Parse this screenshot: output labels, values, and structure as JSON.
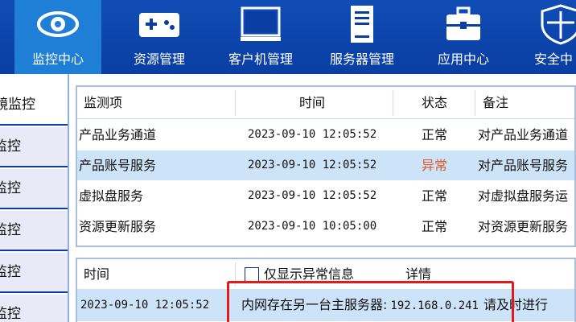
{
  "nav": {
    "items": [
      {
        "label": "监控中心",
        "icon": "eye-icon",
        "active": true
      },
      {
        "label": "资源管理",
        "icon": "gamepad-icon",
        "active": false
      },
      {
        "label": "客户机管理",
        "icon": "monitor-icon",
        "active": false
      },
      {
        "label": "服务器管理",
        "icon": "server-icon",
        "active": false
      },
      {
        "label": "应用中心",
        "icon": "toolbox-icon",
        "active": false
      },
      {
        "label": "安全中",
        "icon": "shield-icon",
        "active": false
      }
    ]
  },
  "sidebar": {
    "items": [
      {
        "label": "镜监控",
        "active": true
      },
      {
        "label": "监控",
        "active": false
      },
      {
        "label": "监控",
        "active": false
      },
      {
        "label": "监控",
        "active": false
      },
      {
        "label": "监控",
        "active": false
      },
      {
        "label": "监控",
        "active": false
      }
    ]
  },
  "monitor_table": {
    "headers": {
      "item": "监测项",
      "time": "时间",
      "status": "状态",
      "note": "备注"
    },
    "rows": [
      {
        "item": "产品业务通道",
        "time": "2023-09-10 12:05:52",
        "status": "正常",
        "note": "对产品业务通道",
        "selected": false
      },
      {
        "item": "产品账号服务",
        "time": "2023-09-10 12:05:52",
        "status": "异常",
        "note": "对产品账号服务",
        "selected": true
      },
      {
        "item": "虚拟盘服务",
        "time": "2023-09-10 12:05:52",
        "status": "正常",
        "note": "对虚拟盘服务运",
        "selected": false
      },
      {
        "item": "资源更新服务",
        "time": "2023-09-10 10:05:00",
        "status": "正常",
        "note": "对资源更新服务",
        "selected": false
      }
    ]
  },
  "log_table": {
    "headers": {
      "time": "时间",
      "filter_label": "仅显示异常信息",
      "detail": "详情"
    },
    "rows": [
      {
        "time": "2023-09-10 12:05:52",
        "detail_prefix": "内网存在另一台主服务器:",
        "detail_ip": "192.168.0.241",
        "detail_suffix": "请及时进行"
      }
    ]
  },
  "colors": {
    "nav_bg": "#0a3ea3",
    "nav_active": "#1f7fd6",
    "row_selected": "#cde3f8",
    "status_abnormal": "#e25822",
    "highlight": "#e01b1b"
  }
}
